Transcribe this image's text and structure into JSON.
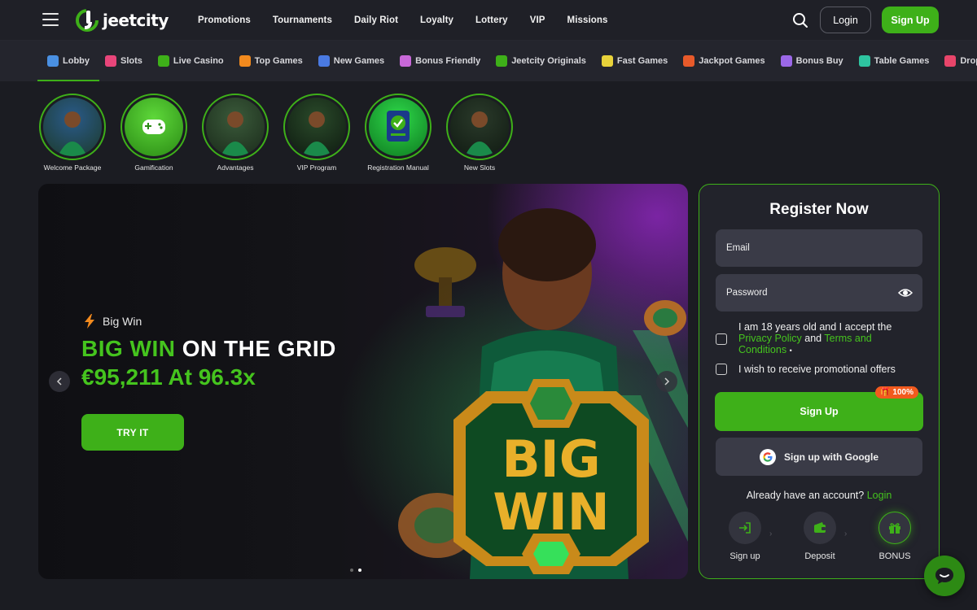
{
  "header": {
    "logo_text": "jeetcity",
    "nav": [
      "Promotions",
      "Tournaments",
      "Daily Riot",
      "Loyalty",
      "Lottery",
      "VIP",
      "Missions"
    ],
    "login_label": "Login",
    "signup_label": "Sign Up"
  },
  "categories": [
    {
      "label": "Lobby",
      "icon": "house-icon",
      "color": "#4a90e2"
    },
    {
      "label": "Slots",
      "icon": "cherry-icon",
      "color": "#e8457a"
    },
    {
      "label": "Live Casino",
      "icon": "play-icon",
      "color": "#3eb019"
    },
    {
      "label": "Top Games",
      "icon": "flame-icon",
      "color": "#f28a1e"
    },
    {
      "label": "New Games",
      "icon": "calendar-icon",
      "color": "#4a7ae2"
    },
    {
      "label": "Bonus Friendly",
      "icon": "gift-icon",
      "color": "#c868d8"
    },
    {
      "label": "Jeetcity Originals",
      "icon": "jeetcity-icon",
      "color": "#3eb019"
    },
    {
      "label": "Fast Games",
      "icon": "rocket-icon",
      "color": "#e8d23a"
    },
    {
      "label": "Jackpot Games",
      "icon": "jackpot-icon",
      "color": "#e85a2a"
    },
    {
      "label": "Bonus Buy",
      "icon": "bonus-buy-icon",
      "color": "#9b68e8"
    },
    {
      "label": "Table Games",
      "icon": "chip-icon",
      "color": "#2ec4a0"
    },
    {
      "label": "Drop",
      "icon": "drop-icon",
      "color": "#e8456a"
    }
  ],
  "stories": [
    {
      "label": "Welcome Package",
      "c1": "#2a5a8a",
      "c2": "#1c3a2a"
    },
    {
      "label": "Gamification",
      "c1": "#5ed83a",
      "c2": "#2a8a14"
    },
    {
      "label": "Advantages",
      "c1": "#3a5a3a",
      "c2": "#1a2a1a"
    },
    {
      "label": "VIP Program",
      "c1": "#2a4a2a",
      "c2": "#0e1a10"
    },
    {
      "label": "Registration Manual",
      "c1": "#2ed84a",
      "c2": "#0e7a20"
    },
    {
      "label": "New Slots",
      "c1": "#2a3a2a",
      "c2": "#101a12"
    }
  ],
  "hero": {
    "tag": "Big Win",
    "title_green": "BIG WIN",
    "title_white": "ON THE GRID",
    "amount": "€95,211 At 96.3x",
    "cta": "TRY IT"
  },
  "register": {
    "title": "Register Now",
    "email_placeholder": "Email",
    "password_placeholder": "Password",
    "terms_prefix": "I am 18 years old and I accept the",
    "privacy_link": "Privacy Policy",
    "and_text": "and",
    "terms_link": "Terms and Conditions",
    "required_mark": "•",
    "promo_label": "I wish to receive promotional offers",
    "signup_label": "Sign Up",
    "bonus_badge": "🎁 100%",
    "google_label": "Sign up with Google",
    "already_text": "Already have an account?",
    "login_link": "Login",
    "steps": [
      "Sign up",
      "Deposit",
      "BONUS"
    ]
  }
}
